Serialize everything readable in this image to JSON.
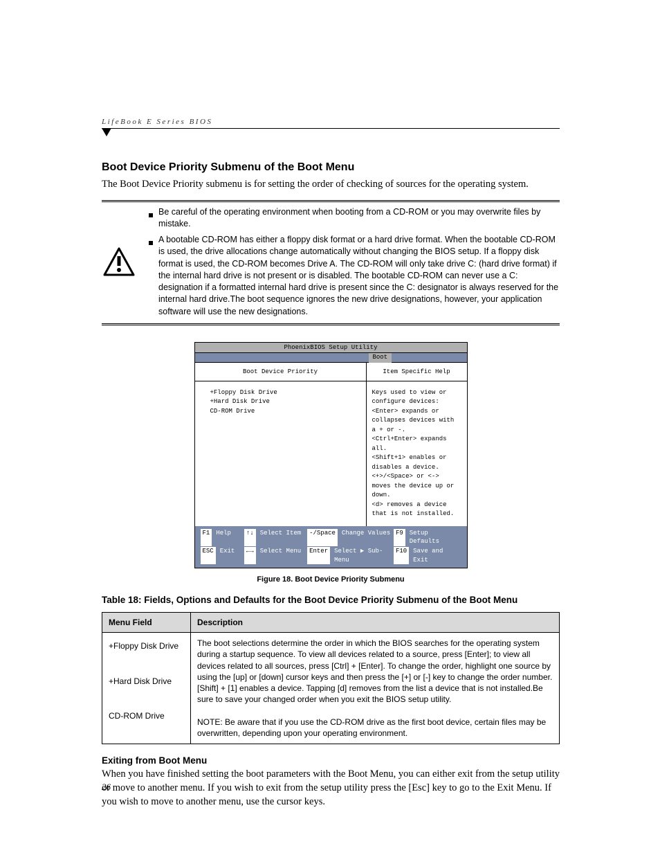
{
  "running_head": "LifeBook E Series BIOS",
  "section_title": "Boot Device Priority Submenu of the Boot Menu",
  "intro": "The Boot Device Priority submenu is for setting the order of checking of sources for the operating system.",
  "caution": {
    "bullet1": "Be careful of the operating environment when booting from a CD-ROM or you may overwrite files by mistake.",
    "bullet2": "A bootable CD-ROM has either a floppy disk format or a hard drive format. When the bootable CD-ROM is used, the drive allocations change automatically without changing the BIOS setup. If a floppy disk format is used, the CD-ROM becomes Drive A. The CD-ROM will only take drive C: (hard drive format) if the internal hard drive is not present or is disabled. The bootable CD-ROM can never use a C: designation if a formatted internal hard drive is present since the C: designator is always reserved for the internal hard drive.The boot sequence ignores the new drive designations, however, your application software will use the new designations."
  },
  "bios": {
    "title": "PhoenixBIOS Setup Utility",
    "tab": "Boot",
    "left_head": "Boot Device Priority",
    "devices": [
      "+Floppy Disk Drive",
      "+Hard Disk Drive",
      " CD-ROM Drive"
    ],
    "right_head": "Item Specific Help",
    "help_lines": [
      "Keys used to view or",
      "configure devices:",
      "",
      "<Enter> expands or",
      "collapses devices with",
      "a + or -.",
      "<Ctrl+Enter> expands",
      "all.",
      "<Shift+1> enables or",
      "disables a device.",
      "<+>/<Space> or <->",
      "moves the device up or",
      "down.",
      "<d> removes a device",
      "that is not installed."
    ],
    "footer": {
      "r1": {
        "k1": "F1",
        "t1": "Help",
        "k2": "↑↓",
        "t2": "Select Item",
        "k3": "-/Space",
        "t3": "Change Values",
        "k4": "F9",
        "t4": "Setup Defaults"
      },
      "r2": {
        "k1": "ESC",
        "t1": "Exit",
        "k2": "←→",
        "t2": "Select Menu",
        "k3": "Enter",
        "t3": "Select ▶ Sub-Menu",
        "k4": "F10",
        "t4": "Save and Exit"
      }
    }
  },
  "figure_caption": "Figure 18.  Boot Device Priority Submenu",
  "table_title": "Table 18: Fields, Options and Defaults for the Boot Device Priority Submenu of the Boot Menu",
  "table": {
    "head_field": "Menu Field",
    "head_desc": "Description",
    "menu_items": "+Floppy Disk Drive\n\n+Hard Disk Drive\n\n CD-ROM Drive",
    "desc": "The boot selections determine the order in which the BIOS searches for the operating system during a startup sequence. To view all devices related to a source, press [Enter]; to view all devices related to all sources, press [Ctrl] + [Enter]. To change the order, highlight one source by using the [up] or [down] cursor keys and then press the [+] or [-] key to change the order number. [Shift] + [1] enables a device. Tapping [d] removes from the list a device that is not installed.Be sure to save your changed order when you exit the BIOS setup utility.\n\nNOTE: Be aware that if you use the CD-ROM drive as the first boot device, certain files may be overwritten, depending upon your operating environment."
  },
  "exit_head": "Exiting from Boot Menu",
  "exit_body": "When you have finished setting the boot parameters with the Boot Menu, you can either exit from the setup utility or move to another menu. If you wish to exit from the setup utility press the [Esc] key to go to the Exit Menu. If you wish to move to another menu, use the cursor keys.",
  "page_number": "26"
}
